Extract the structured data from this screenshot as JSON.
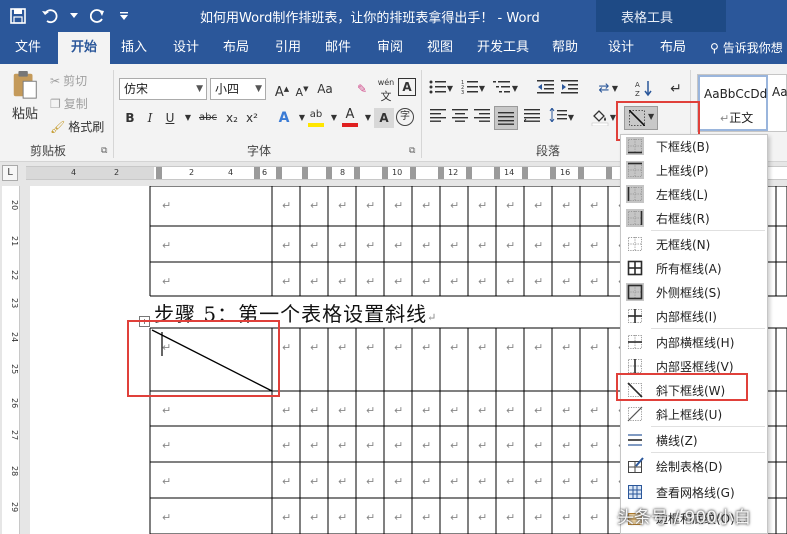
{
  "window": {
    "title": "如何用Word制作排班表，让你的排班表拿得出手！ - Word",
    "context_tab_group": "表格工具"
  },
  "tabs": [
    {
      "label": "文件"
    },
    {
      "label": "开始"
    },
    {
      "label": "插入"
    },
    {
      "label": "设计"
    },
    {
      "label": "布局"
    },
    {
      "label": "引用"
    },
    {
      "label": "邮件"
    },
    {
      "label": "审阅"
    },
    {
      "label": "视图"
    },
    {
      "label": "开发工具"
    },
    {
      "label": "帮助"
    },
    {
      "label": "设计"
    },
    {
      "label": "布局"
    }
  ],
  "active_tab": "开始",
  "tell_me": "告诉我你想",
  "ribbon": {
    "clipboard": {
      "paste": "粘贴",
      "cut": "剪切",
      "copy": "复制",
      "format_painter": "格式刷",
      "label": "剪贴板"
    },
    "font": {
      "name": "仿宋",
      "size": "小四",
      "label": "字体",
      "buttons": [
        "B",
        "I",
        "U",
        "abc",
        "x₂",
        "x²",
        "A",
        "ab",
        "A",
        "Aa",
        "A",
        "A",
        "字"
      ]
    },
    "paragraph": {
      "label": "段落"
    },
    "styles": {
      "sample": "AaBbCcDd",
      "sample2": "Aa",
      "normal": "正文"
    }
  },
  "ruler": {
    "corner": "L",
    "h_numbers": [
      "4",
      "2",
      "2",
      "4",
      "6",
      "8",
      "10",
      "12",
      "14",
      "16",
      "18",
      "20",
      "22",
      "24"
    ],
    "v_numbers": [
      "20",
      "21",
      "22",
      "23",
      "24",
      "25",
      "26",
      "27",
      "28",
      "29"
    ]
  },
  "document": {
    "heading": "步骤 5：第一个表格设置斜线",
    "para_mark": "↵",
    "table_move": "+"
  },
  "border_menu": {
    "items": [
      {
        "label": "下框线(B)",
        "icon": "bottom-border-icon",
        "checked": true
      },
      {
        "label": "上框线(P)",
        "icon": "top-border-icon",
        "checked": true
      },
      {
        "label": "左框线(L)",
        "icon": "left-border-icon",
        "checked": true
      },
      {
        "label": "右框线(R)",
        "icon": "right-border-icon",
        "checked": true
      },
      {
        "label": "无框线(N)",
        "icon": "no-border-icon",
        "checked": false
      },
      {
        "label": "所有框线(A)",
        "icon": "all-borders-icon",
        "checked": false
      },
      {
        "label": "外侧框线(S)",
        "icon": "outside-borders-icon",
        "checked": true
      },
      {
        "label": "内部框线(I)",
        "icon": "inside-borders-icon",
        "checked": false
      },
      {
        "label": "内部横框线(H)",
        "icon": "inside-horizontal-border-icon",
        "checked": false
      },
      {
        "label": "内部竖框线(V)",
        "icon": "inside-vertical-border-icon",
        "checked": false
      },
      {
        "label": "斜下框线(W)",
        "icon": "diagonal-down-border-icon",
        "checked": false
      },
      {
        "label": "斜上框线(U)",
        "icon": "diagonal-up-border-icon",
        "checked": false
      },
      {
        "label": "横线(Z)",
        "icon": "horizontal-line-icon",
        "checked": false
      },
      {
        "label": "绘制表格(D)",
        "icon": "draw-table-icon",
        "checked": false
      },
      {
        "label": "查看网格线(G)",
        "icon": "view-gridlines-icon",
        "checked": false
      },
      {
        "label": "边框和底纹(O)...",
        "icon": "borders-shading-icon",
        "checked": false
      }
    ]
  },
  "watermark": "头条号 / 900小白",
  "colors": {
    "word_blue": "#2b579a",
    "highlight_red": "#e0403a",
    "font_color_red": "#e02020",
    "highlight_yellow": "#ffe600"
  }
}
